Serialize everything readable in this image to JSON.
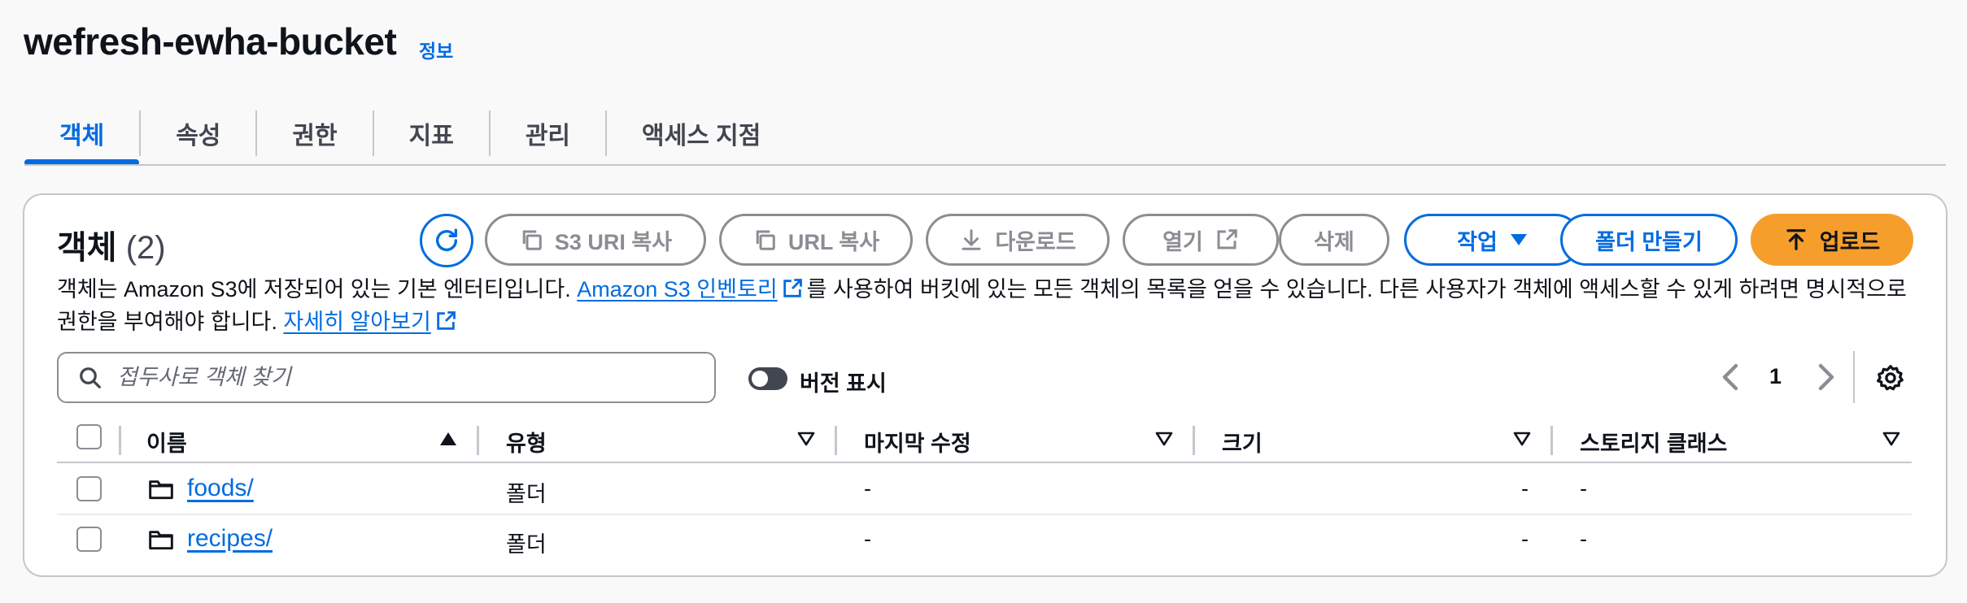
{
  "header": {
    "bucket_name": "wefresh-ewha-bucket",
    "info_label": "정보"
  },
  "tabs": [
    {
      "label": "객체",
      "active": true
    },
    {
      "label": "속성",
      "active": false
    },
    {
      "label": "권한",
      "active": false
    },
    {
      "label": "지표",
      "active": false
    },
    {
      "label": "관리",
      "active": false
    },
    {
      "label": "액세스 지점",
      "active": false
    }
  ],
  "objects_panel": {
    "heading": "객체",
    "count": "(2)",
    "buttons": {
      "copy_s3_uri": "S3 URI 복사",
      "copy_url": "URL 복사",
      "download": "다운로드",
      "open": "열기",
      "delete": "삭제",
      "actions": "작업",
      "create_folder": "폴더 만들기",
      "upload": "업로드"
    },
    "description": {
      "part1": "객체는 Amazon S3에 저장되어 있는 기본 엔터티입니다. ",
      "inventory_link": "Amazon S3 인벤토리",
      "part2": "를 사용하여 버킷에 있는 모든 객체의 목록을 얻을 수 있습니다. 다른 사용자가 객체에 액세스할 수 있게 하려면 명시적으로 권한을 부여해야 합니다. ",
      "learn_more_link": "자세히 알아보기"
    },
    "search": {
      "placeholder": "접두사로 객체 찾기",
      "value": ""
    },
    "show_versions": {
      "label": "버전 표시",
      "enabled": false
    },
    "pagination": {
      "current_page": "1"
    },
    "table": {
      "columns": [
        "이름",
        "유형",
        "마지막 수정",
        "크기",
        "스토리지 클래스"
      ],
      "rows": [
        {
          "name": "foods/",
          "type": "폴더",
          "last_modified": "-",
          "size": "-",
          "storage_class": "-"
        },
        {
          "name": "recipes/",
          "type": "폴더",
          "last_modified": "-",
          "size": "-",
          "storage_class": "-"
        }
      ]
    }
  },
  "colors": {
    "accent": "#006ce0",
    "upload_button": "#f59e2b",
    "disabled": "#8c8c94"
  }
}
